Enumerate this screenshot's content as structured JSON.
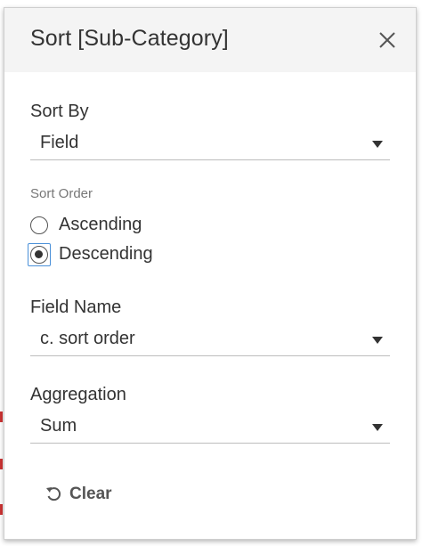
{
  "dialog": {
    "title": "Sort [Sub-Category]",
    "close_icon": "close-icon"
  },
  "sort_by": {
    "label": "Sort By",
    "value": "Field"
  },
  "sort_order": {
    "label": "Sort Order",
    "options": [
      {
        "label": "Ascending",
        "selected": false
      },
      {
        "label": "Descending",
        "selected": true
      }
    ]
  },
  "field_name": {
    "label": "Field Name",
    "value": "c. sort order"
  },
  "aggregation": {
    "label": "Aggregation",
    "value": "Sum"
  },
  "clear": {
    "label": "Clear",
    "icon": "undo-icon"
  },
  "colors": {
    "header_bg": "#f4f4f4",
    "focus_ring": "#4a90d9",
    "text": "#333333"
  }
}
